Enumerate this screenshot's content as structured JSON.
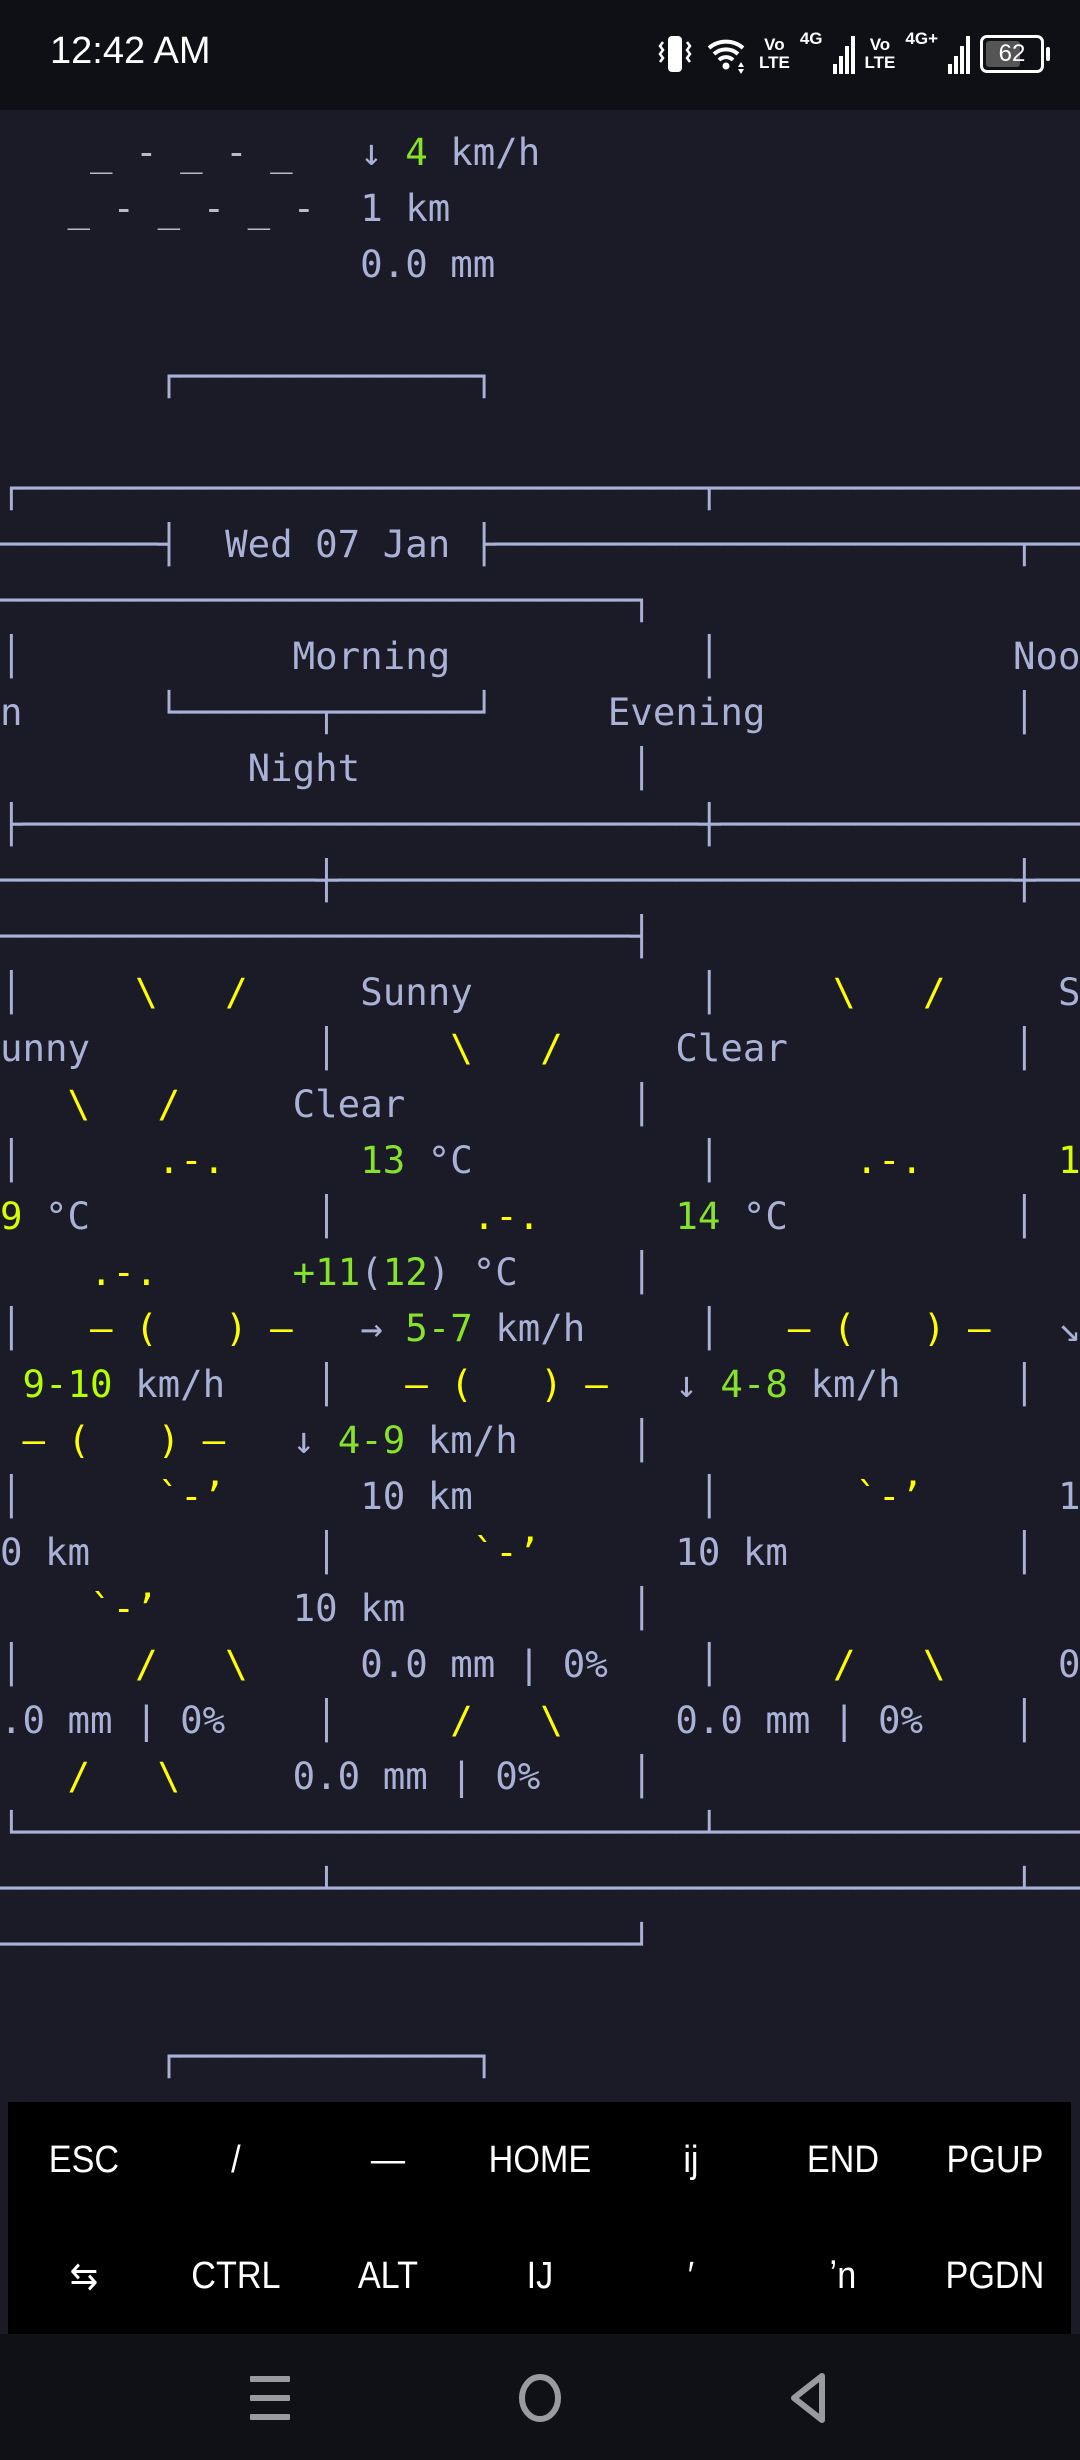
{
  "status_bar": {
    "time": "12:42 AM",
    "vo_lte_1": "Vo\nLTE",
    "net_1": "4G",
    "vo_lte_2": "Vo\nLTE",
    "net_2": "4G+",
    "battery": "62"
  },
  "colors": {
    "d": "#a9b1d6",
    "y": "#ffff00",
    "g": "#87e22a",
    "gy": "#d7ff00",
    "yg": "#b5ff00",
    "f": "#b8bcc8"
  },
  "terminal": {
    "rows": [
      [
        [
          "    _ - _ - _   ",
          "f"
        ],
        [
          "↓ ",
          "d"
        ],
        [
          "4",
          "g"
        ],
        [
          " km/h",
          "d"
        ]
      ],
      [
        [
          "   _ - _ - _ -  ",
          "f"
        ],
        [
          "1 km",
          "d"
        ]
      ],
      [
        [
          "                0.0 mm",
          "d"
        ]
      ],
      [],
      [
        [
          "       ┌─────────────┐",
          "d"
        ]
      ],
      [],
      [
        [
          "┌──────────────────────────────┬────────────────",
          "d"
        ]
      ],
      [
        [
          "───────┤  Wed 07 Jan ├───────────────────────┬──",
          "d"
        ]
      ],
      [
        [
          "────────────────────────────┐",
          "d"
        ]
      ],
      [
        [
          "│            Morning           │             Noo",
          "d"
        ]
      ],
      [
        [
          "n      └──────┬──────┘     Evening           │  ",
          "d"
        ]
      ],
      [
        [
          "           Night            │",
          "d"
        ]
      ],
      [
        [
          "├──────────────────────────────┼────────────────",
          "d"
        ]
      ],
      [
        [
          "──────────────┼──────────────────────────────┼──",
          "d"
        ]
      ],
      [
        [
          "────────────────────────────┤",
          "d"
        ]
      ],
      [
        [
          "│     ",
          "d"
        ],
        [
          "\\   /",
          "y"
        ],
        [
          "     Sunny          │     ",
          "d"
        ],
        [
          "\\   /",
          "y"
        ],
        [
          "     S",
          "d"
        ]
      ],
      [
        [
          "unny          │     ",
          "d"
        ],
        [
          "\\   /",
          "y"
        ],
        [
          "     Clear          │  ",
          "d"
        ]
      ],
      [
        [
          "   ",
          "d"
        ],
        [
          "\\   /",
          "y"
        ],
        [
          "     Clear          │",
          "d"
        ]
      ],
      [
        [
          "│      ",
          "d"
        ],
        [
          ".-.",
          "y"
        ],
        [
          "      ",
          "d"
        ],
        [
          "13",
          "g"
        ],
        [
          " °C          │      ",
          "d"
        ],
        [
          ".-.",
          "y"
        ],
        [
          "      ",
          "d"
        ],
        [
          "1",
          "gy"
        ]
      ],
      [
        [
          "9",
          "gy"
        ],
        [
          " °C          │      ",
          "d"
        ],
        [
          ".-.",
          "y"
        ],
        [
          "      ",
          "d"
        ],
        [
          "14",
          "g"
        ],
        [
          " °C          │  ",
          "d"
        ]
      ],
      [
        [
          "    ",
          "d"
        ],
        [
          ".-.",
          "y"
        ],
        [
          "      ",
          "d"
        ],
        [
          "+11",
          "g"
        ],
        [
          "(",
          "d"
        ],
        [
          "12",
          "g"
        ],
        [
          ")",
          "d"
        ],
        [
          " °C     │",
          "d"
        ]
      ],
      [
        [
          "│   ",
          "d"
        ],
        [
          "― (   ) ―",
          "y"
        ],
        [
          "   → ",
          "d"
        ],
        [
          "5-7",
          "g"
        ],
        [
          " km/h     │   ",
          "d"
        ],
        [
          "― (   ) ―",
          "y"
        ],
        [
          "   ↘",
          "d"
        ]
      ],
      [
        [
          " ",
          "d"
        ],
        [
          "9-10",
          "yg"
        ],
        [
          " km/h    │   ",
          "d"
        ],
        [
          "― (   ) ―",
          "y"
        ],
        [
          "   ↓ ",
          "d"
        ],
        [
          "4-8",
          "g"
        ],
        [
          " km/h     │  ",
          "d"
        ]
      ],
      [
        [
          " ",
          "d"
        ],
        [
          "― (   ) ―",
          "y"
        ],
        [
          "   ↓ ",
          "d"
        ],
        [
          "4-9",
          "g"
        ],
        [
          " km/h     │",
          "d"
        ]
      ],
      [
        [
          "│      ",
          "d"
        ],
        [
          "`-’",
          "y"
        ],
        [
          "      10 km          │      ",
          "d"
        ],
        [
          "`-’",
          "y"
        ],
        [
          "      1",
          "d"
        ]
      ],
      [
        [
          "0 km          │      ",
          "d"
        ],
        [
          "`-’",
          "y"
        ],
        [
          "      10 km          │  ",
          "d"
        ]
      ],
      [
        [
          "    ",
          "d"
        ],
        [
          "`-’",
          "y"
        ],
        [
          "      10 km          │",
          "d"
        ]
      ],
      [
        [
          "│     ",
          "d"
        ],
        [
          "/   \\",
          "y"
        ],
        [
          "     0.0 mm | 0%    │     ",
          "d"
        ],
        [
          "/   \\",
          "y"
        ],
        [
          "     0",
          "d"
        ]
      ],
      [
        [
          ".0 mm | 0%    │     ",
          "d"
        ],
        [
          "/   \\",
          "y"
        ],
        [
          "     0.0 mm | 0%    │  ",
          "d"
        ]
      ],
      [
        [
          "   ",
          "d"
        ],
        [
          "/   \\",
          "y"
        ],
        [
          "     0.0 mm | 0%    │",
          "d"
        ]
      ],
      [
        [
          "└──────────────────────────────┴────────────────",
          "d"
        ]
      ],
      [
        [
          "──────────────┴──────────────────────────────┴──",
          "d"
        ]
      ],
      [
        [
          "────────────────────────────┘",
          "d"
        ]
      ],
      [],
      [
        [
          "       ┌─────────────┐",
          "d"
        ]
      ]
    ]
  },
  "extra_keys": {
    "row1": [
      "ESC",
      "/",
      "—",
      "HOME",
      "ij",
      "END",
      "PGUP"
    ],
    "row2": [
      "⇆",
      "CTRL",
      "ALT",
      "IJ",
      "′",
      "ʼn",
      "PGDN"
    ]
  },
  "nav_bar": {
    "recents": "menu-icon",
    "home": "circle-icon",
    "back": "triangle-icon"
  }
}
